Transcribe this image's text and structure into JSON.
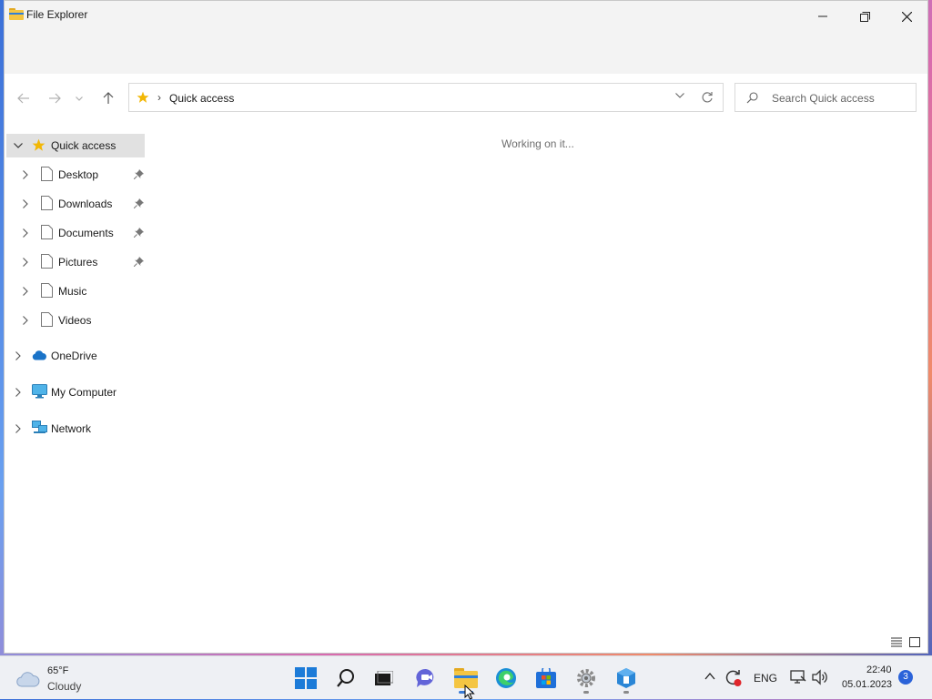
{
  "window": {
    "title": "File Explorer",
    "icon": "folder-icon",
    "controls": [
      "minimize-icon",
      "maximize-icon",
      "close-icon"
    ]
  },
  "navigation": {
    "back": "back-arrow-icon",
    "forward": "forward-arrow-icon",
    "recent": "chevron-down-icon",
    "up": "up-arrow-icon"
  },
  "address_bar": {
    "location_icon": "star-icon",
    "separator": "›",
    "path": "Quick access"
  },
  "search": {
    "placeholder": "Search Quick access"
  },
  "sidebar": {
    "quick_access": {
      "label": "Quick access",
      "expanded": true,
      "items": [
        {
          "label": "Desktop",
          "pinned": true
        },
        {
          "label": "Downloads",
          "pinned": true
        },
        {
          "label": "Documents",
          "pinned": true
        },
        {
          "label": "Pictures",
          "pinned": true
        },
        {
          "label": "Music",
          "pinned": false
        },
        {
          "label": "Videos",
          "pinned": false
        }
      ]
    },
    "roots": [
      {
        "label": "OneDrive",
        "icon": "cloud-icon"
      },
      {
        "label": "My Computer",
        "icon": "monitor-icon"
      },
      {
        "label": "Network",
        "icon": "network-icon"
      }
    ]
  },
  "content": {
    "status": "Working on it..."
  },
  "taskbar": {
    "weather": {
      "temp": "65°F",
      "condition": "Cloudy"
    },
    "apps": [
      "start-icon",
      "search-icon",
      "task-view-icon",
      "chat-icon",
      "file-explorer-icon",
      "edge-icon",
      "store-icon",
      "settings-icon",
      "app-icon"
    ],
    "tray": {
      "language": "ENG",
      "time": "22:40",
      "date": "05.01.2023",
      "notifications": "3"
    }
  },
  "colors": {
    "accent": "#3a7bd5",
    "folder_yellow": "#f4c542",
    "star_yellow": "#f2b705",
    "selected_bg": "#e1e1e1",
    "badge_blue": "#2b63d9"
  }
}
